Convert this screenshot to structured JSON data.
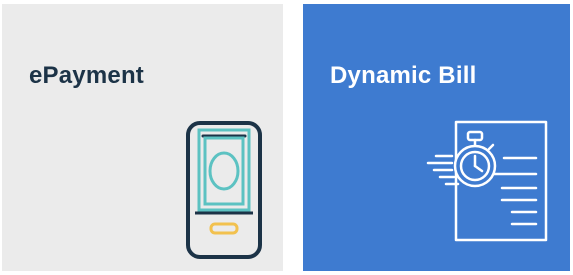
{
  "tiles": {
    "epayment": {
      "title": "ePayment",
      "icon": "mobile-payment-icon",
      "background": "#ebebeb",
      "title_color": "#1c3347"
    },
    "dynamic_bill": {
      "title": "Dynamic Bill",
      "icon": "bill-stopwatch-icon",
      "background": "#3e7bd0",
      "title_color": "#ffffff"
    }
  },
  "colors": {
    "phone_outline": "#1c3347",
    "bill_accent": "#5cc2c2",
    "button_accent": "#f2c14e",
    "icon_white": "#ffffff"
  }
}
